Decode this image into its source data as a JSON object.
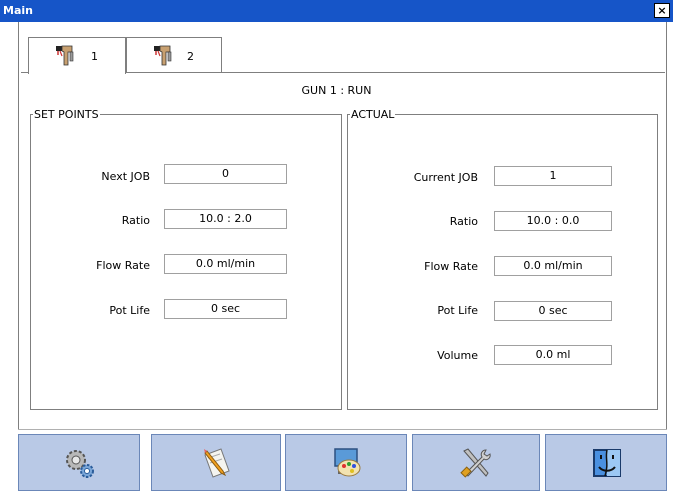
{
  "window": {
    "title": "Main",
    "close_symbol": "×"
  },
  "tabs": [
    {
      "label": "1",
      "icon": "spray-gun-icon",
      "active": true
    },
    {
      "label": "2",
      "icon": "spray-gun-icon",
      "active": false
    }
  ],
  "status": "GUN 1 : RUN",
  "set_points": {
    "title": "SET POINTS",
    "fields": [
      {
        "label": "Next JOB",
        "value": "0"
      },
      {
        "label": "Ratio",
        "value": "10.0 : 2.0"
      },
      {
        "label": "Flow Rate",
        "value": "0.0 ml/min"
      },
      {
        "label": "Pot Life",
        "value": "0 sec"
      }
    ]
  },
  "actual": {
    "title": "ACTUAL",
    "fields": [
      {
        "label": "Current JOB",
        "value": "1"
      },
      {
        "label": "Ratio",
        "value": "10.0 : 0.0"
      },
      {
        "label": "Flow Rate",
        "value": "0.0 ml/min"
      },
      {
        "label": "Pot Life",
        "value": "0 sec"
      },
      {
        "label": "Volume",
        "value": "0.0 ml"
      }
    ]
  },
  "toolbar": [
    {
      "icon": "gears-icon"
    },
    {
      "icon": "edit-document-icon"
    },
    {
      "icon": "display-palette-icon"
    },
    {
      "icon": "tools-icon"
    },
    {
      "icon": "finder-icon"
    }
  ],
  "colors": {
    "titlebar": "#1655c8",
    "toolbar_button": "#b9c9e6",
    "border": "#7f7f7f"
  }
}
